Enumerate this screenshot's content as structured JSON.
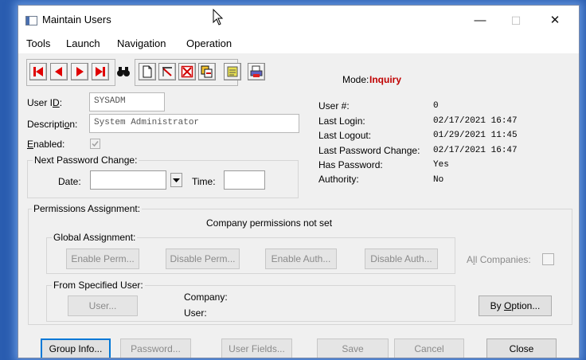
{
  "window": {
    "title": "Maintain Users",
    "controls": {
      "minimize": "—",
      "maximize": "☐",
      "close": "✕"
    }
  },
  "menu": [
    "Tools",
    "Launch",
    "Navigation",
    "Operation"
  ],
  "toolbar": {
    "buttons": [
      "first-record",
      "previous-record",
      "next-record",
      "last-record",
      "find",
      "new",
      "edit",
      "delete",
      "copy",
      "notes",
      "print"
    ]
  },
  "mode": {
    "label": "Mode:",
    "value": "Inquiry",
    "color": "#c00000"
  },
  "form": {
    "user_id": {
      "label_pre": "User I",
      "label_u": "D",
      "label_post": ":",
      "value": "SYSADM"
    },
    "description": {
      "label_pre": "Descripti",
      "label_u": "o",
      "label_post": "n:",
      "value": "System Administrator"
    },
    "enabled": {
      "label_u": "E",
      "label_post": "nabled:",
      "checked": true
    },
    "next_password_change": {
      "title": "Next Password Change:",
      "date_label": "Date:",
      "time_label": "Time:",
      "date_value": "",
      "time_value": ""
    }
  },
  "info": {
    "user_num_label": "User #:",
    "user_num_value": "0",
    "last_login_label": "Last Login:",
    "last_login_value": "02/17/2021  16:47",
    "last_logout_label": "Last Logout:",
    "last_logout_value": "01/29/2021  11:45",
    "last_pw_change_label": "Last Password Change:",
    "last_pw_change_value": "02/17/2021  16:47",
    "has_password_label": "Has Password:",
    "has_password_value": "Yes",
    "authority_label": "Authority:",
    "authority_value": "No"
  },
  "permissions": {
    "title": "Permissions Assignment:",
    "status": "Company permissions not set",
    "global_title": "Global Assignment:",
    "enable_perm": "Enable Perm...",
    "disable_perm": "Disable Perm...",
    "enable_auth": "Enable Auth...",
    "disable_auth": "Disable Auth...",
    "all_companies_pre": "A",
    "all_companies_u": "l",
    "all_companies_post": "l Companies:",
    "from_user_title": "From Specified User:",
    "user_button": "User...",
    "company_label": "Company:",
    "user_label": "User:",
    "by_option_pre": "By ",
    "by_option_u": "O",
    "by_option_post": "ption..."
  },
  "bottom_buttons": {
    "group_info": "Group Info...",
    "password": "Password...",
    "user_fields": "User Fields...",
    "save": "Save",
    "cancel": "Cancel",
    "close": "Close"
  }
}
